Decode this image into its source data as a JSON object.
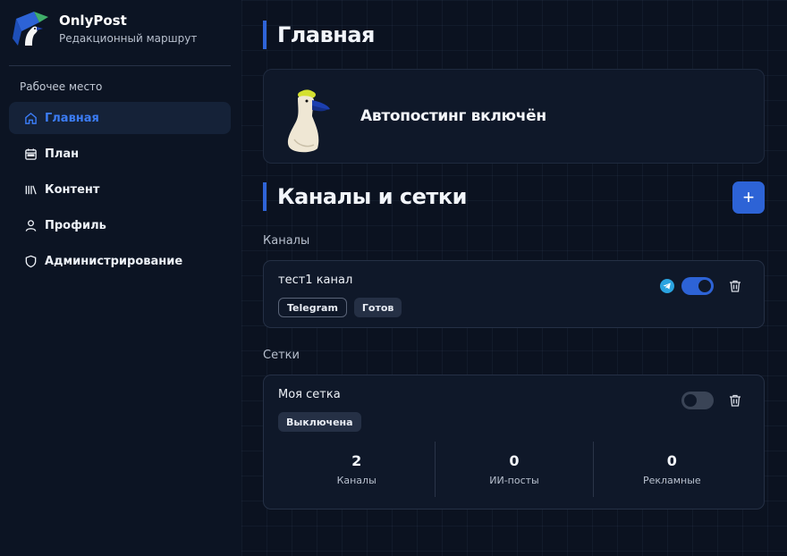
{
  "brand": {
    "name": "OnlyPost",
    "subtitle": "Редакционный маршрут"
  },
  "sidebar": {
    "section_label": "Рабочее место",
    "items": [
      {
        "label": "Главная",
        "icon": "home-icon",
        "active": true
      },
      {
        "label": "План",
        "icon": "calendar-icon"
      },
      {
        "label": "Контент",
        "icon": "library-icon"
      },
      {
        "label": "Профиль",
        "icon": "user-icon"
      },
      {
        "label": "Администрирование",
        "icon": "shield-icon"
      }
    ]
  },
  "main": {
    "title": "Главная",
    "hero_text": "Автопостинг включён",
    "channels_title": "Каналы и сетки",
    "add_label": "+",
    "channels_label": "Каналы",
    "networks_label": "Сетки",
    "channel": {
      "name": "тест1 канал",
      "badges": [
        "Telegram",
        "Готов"
      ],
      "enabled": true
    },
    "network": {
      "name": "Моя сетка",
      "badge": "Выключена",
      "enabled": false,
      "stats": [
        {
          "value": "2",
          "label": "Каналы"
        },
        {
          "value": "0",
          "label": "ИИ-посты"
        },
        {
          "value": "0",
          "label": "Рекламные"
        }
      ]
    }
  },
  "colors": {
    "accent": "#2d63d6",
    "active_text": "#3b7cf5",
    "background": "#0b1220"
  }
}
